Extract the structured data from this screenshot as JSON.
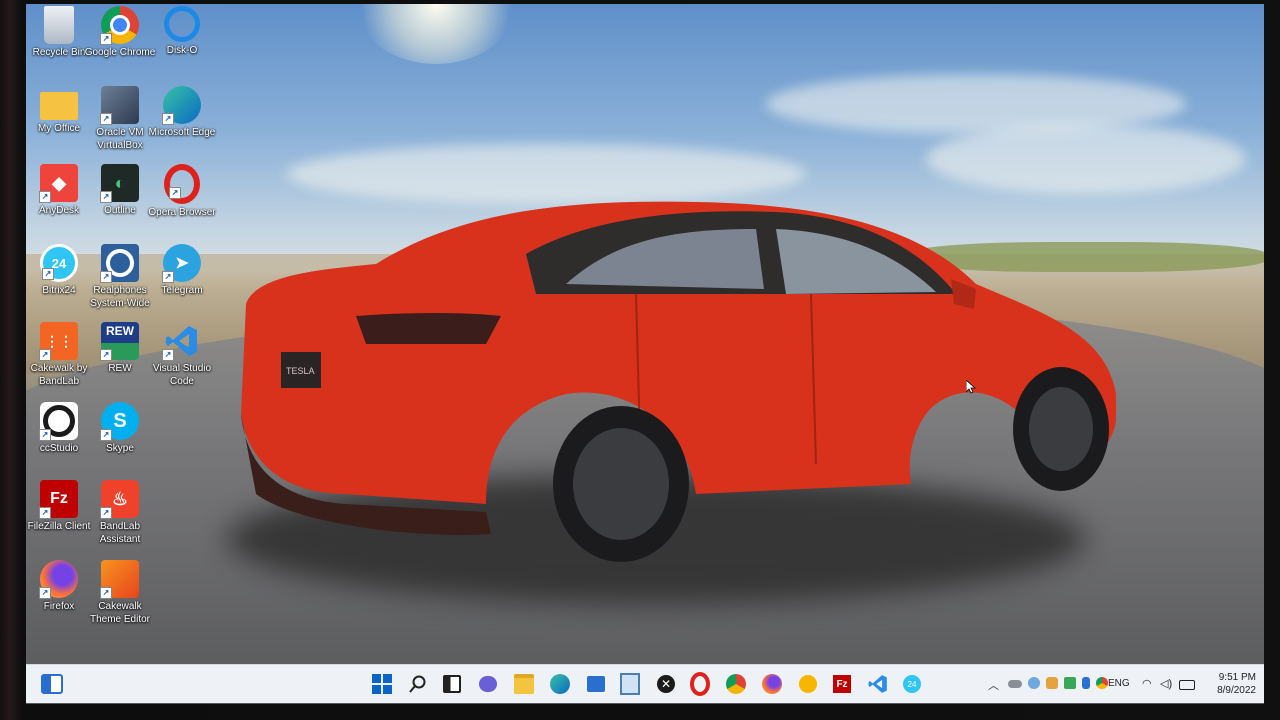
{
  "desktop_icons": [
    {
      "label": "Recycle Bin",
      "icon": "recycle-bin-icon"
    },
    {
      "label": "Google Chrome",
      "icon": "chrome-icon"
    },
    {
      "label": "Disk-O",
      "icon": "disk-o-icon"
    },
    {
      "label": "My Office",
      "icon": "folder-icon"
    },
    {
      "label": "Oracle VM VirtualBox",
      "icon": "virtualbox-icon"
    },
    {
      "label": "Microsoft Edge",
      "icon": "edge-icon"
    },
    {
      "label": "AnyDesk",
      "icon": "anydesk-icon"
    },
    {
      "label": "Outline",
      "icon": "outline-icon"
    },
    {
      "label": "Opera Browser",
      "icon": "opera-icon"
    },
    {
      "label": "Bitrix24",
      "icon": "bitrix24-icon"
    },
    {
      "label": "Realphones System-Wide",
      "icon": "realphones-icon"
    },
    {
      "label": "Telegram",
      "icon": "telegram-icon"
    },
    {
      "label": "Cakewalk by BandLab",
      "icon": "cakewalk-icon"
    },
    {
      "label": "REW",
      "icon": "rew-icon"
    },
    {
      "label": "Visual Studio Code",
      "icon": "vscode-icon"
    },
    {
      "label": "ccStudio",
      "icon": "ccstudio-icon"
    },
    {
      "label": "Skype",
      "icon": "skype-icon"
    },
    {
      "label": "FileZilla Client",
      "icon": "filezilla-icon"
    },
    {
      "label": "BandLab Assistant",
      "icon": "bandlab-icon"
    },
    {
      "label": "Firefox",
      "icon": "firefox-icon"
    },
    {
      "label": "Cakewalk Theme Editor",
      "icon": "cakewalk-theme-editor-icon"
    }
  ],
  "icon_glyphs": {
    "rew": "REW",
    "bitrix": "24",
    "skype": "S",
    "filezilla": "Fz",
    "opera": "O",
    "outline": "◐",
    "anydesk": "◆"
  },
  "wallpaper": {
    "car_badge": "TESLA",
    "car_color": "#d8321c"
  },
  "taskbar": {
    "widgets": "widgets-icon",
    "apps": [
      "start-icon",
      "search-icon",
      "task-view-icon",
      "chat-icon",
      "file-explorer-icon",
      "edge-icon",
      "store-icon",
      "notepad-icon",
      "xbox-icon",
      "opera-icon",
      "chrome-icon",
      "firefox-icon",
      "sticky-notes-icon",
      "filezilla-icon",
      "vscode-icon",
      "bitrix24-icon"
    ],
    "tray_icons": [
      "chevron-up-icon",
      "onedrive-icon",
      "cloud-icon",
      "app-tray-icon",
      "shield-icon",
      "bluetooth-icon",
      "chrome-tray-icon"
    ],
    "language": "ENG",
    "time": "9:51 PM",
    "date": "8/9/2022"
  },
  "colors": {
    "taskbar_bg": "#eef1f6",
    "accent": "#0a64c8"
  }
}
